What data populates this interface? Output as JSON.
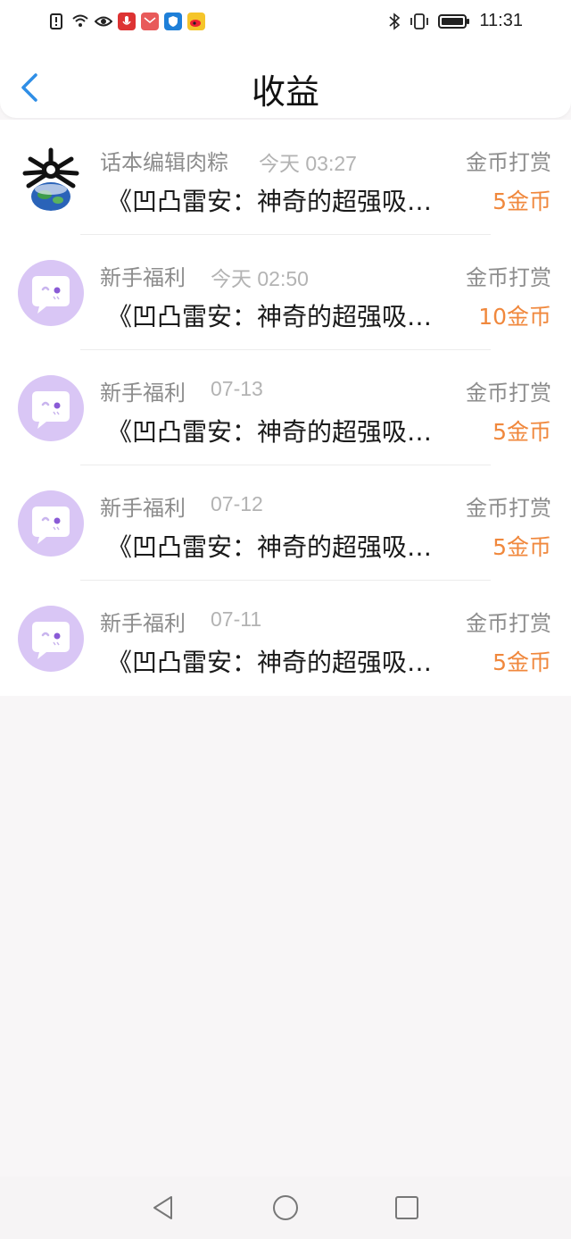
{
  "status_bar": {
    "time": "11:31",
    "left_icons": [
      "alert-icon",
      "wifi-icon",
      "eye-icon",
      "mic-app-icon",
      "mail-app-icon",
      "shield-app-icon",
      "weibo-icon"
    ],
    "right_icons": [
      "bluetooth-icon",
      "vibrate-icon",
      "battery-icon"
    ]
  },
  "header": {
    "title": "收益",
    "back_icon": "chevron-left-icon"
  },
  "colors": {
    "accent": "#2f8ee6",
    "amount": "#f0883d",
    "avatar_purple": "#d9c6f5"
  },
  "items": [
    {
      "name": "话本编辑肉粽",
      "time": "今天 03:27",
      "type": "金币打赏",
      "work": "《凹凸雷安：神奇的超强吸…",
      "amount": "5金币",
      "avatar": "editor-avatar"
    },
    {
      "name": "新手福利",
      "time": "今天 02:50",
      "type": "金币打赏",
      "work": "《凹凸雷安：神奇的超强吸…",
      "amount": "10金币",
      "avatar": "chat-bubble-avatar"
    },
    {
      "name": "新手福利",
      "time": "07-13",
      "type": "金币打赏",
      "work": "《凹凸雷安：神奇的超强吸…",
      "amount": "5金币",
      "avatar": "chat-bubble-avatar"
    },
    {
      "name": "新手福利",
      "time": "07-12",
      "type": "金币打赏",
      "work": "《凹凸雷安：神奇的超强吸…",
      "amount": "5金币",
      "avatar": "chat-bubble-avatar"
    },
    {
      "name": "新手福利",
      "time": "07-11",
      "type": "金币打赏",
      "work": "《凹凸雷安：神奇的超强吸…",
      "amount": "5金币",
      "avatar": "chat-bubble-avatar"
    }
  ],
  "nav_bar": [
    "back-triangle-icon",
    "home-circle-icon",
    "recents-square-icon"
  ]
}
